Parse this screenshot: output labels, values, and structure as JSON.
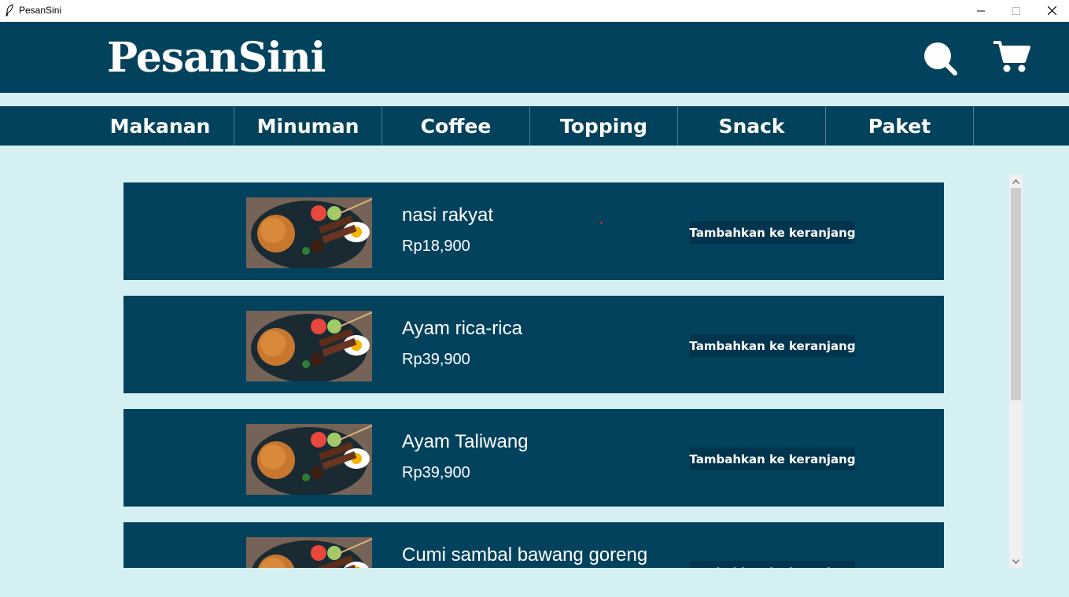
{
  "window": {
    "title": "PesanSini",
    "controls": {
      "minimize": "minimize-icon",
      "maximize": "maximize-icon",
      "close": "close-icon"
    }
  },
  "header": {
    "logo": "PesanSini",
    "icons": {
      "search": "search-icon",
      "cart": "cart-icon"
    }
  },
  "nav": {
    "items": [
      {
        "label": "Makanan"
      },
      {
        "label": "Minuman"
      },
      {
        "label": "Coffee"
      },
      {
        "label": "Topping"
      },
      {
        "label": "Snack"
      },
      {
        "label": "Paket"
      }
    ]
  },
  "menu": {
    "items": [
      {
        "name": "nasi rakyat",
        "price": "Rp18,900",
        "button": "Tambahkan ke keranjang",
        "image": "nasi-goreng-sate-image"
      },
      {
        "name": "Ayam rica-rica",
        "price": "Rp39,900",
        "button": "Tambahkan ke keranjang",
        "image": "nasi-goreng-sate-image"
      },
      {
        "name": "Ayam Taliwang",
        "price": "Rp39,900",
        "button": "Tambahkan ke keranjang",
        "image": "nasi-goreng-sate-image"
      },
      {
        "name": "Cumi sambal bawang goreng",
        "price": "",
        "button": "Tambahkan ke keranjang",
        "image": "nasi-goreng-sate-image"
      }
    ]
  },
  "colors": {
    "primary": "#03425d",
    "background": "#d4f0f3",
    "button": "#01354d",
    "text": "#ffffff"
  }
}
